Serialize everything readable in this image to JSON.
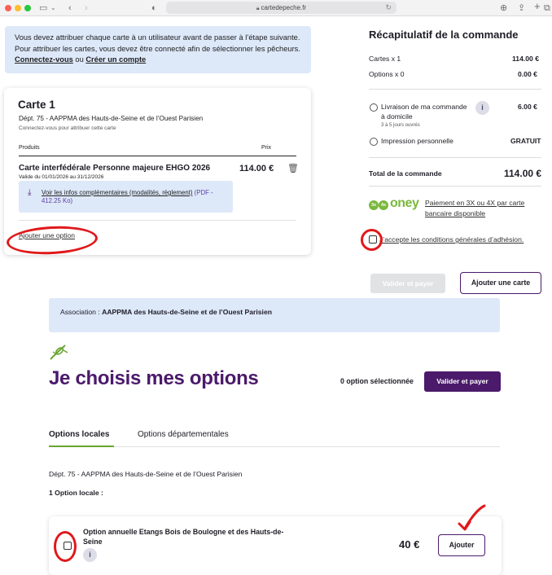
{
  "browser": {
    "url": "cartedepeche.fr"
  },
  "notice": {
    "line1": "Vous devez attribuer chaque carte à un utilisateur avant de passer à l’étape suivante.",
    "line2": "Pour attribuer les cartes, vous devez être connecté afin de sélectionner les pêcheurs.",
    "login_link": "Connectez-vous",
    "or_text": "ou",
    "signup_link": "Créer un compte"
  },
  "card": {
    "title": "Carte 1",
    "subtitle": "Dépt. 75 - AAPPMA des Hauts-de-Seine et de l’Ouest Parisien",
    "connect_hint": "Connectez-vous pour attribuer cette carte",
    "col_products": "Produits",
    "col_price": "Prix",
    "product_name": "Carte interfédérale Personne majeure EHGO 2026",
    "product_validity": "Valide du 01/01/2026 au 31/12/2026",
    "product_price": "114.00 €",
    "info_link": "Voir les infos complémentaires (modalités, règlement)",
    "info_pdf": "(PDF - 412.25 Ko)",
    "add_option": "Ajouter une option"
  },
  "summary": {
    "title": "Récapitulatif de la commande",
    "cards_label": "Cartes x 1",
    "cards_value": "114.00 €",
    "options_label": "Options x 0",
    "options_value": "0.00 €",
    "delivery_label": "Livraison de ma commande à domicile",
    "delivery_note": "3 à 5 jours ouvrés",
    "delivery_value": "6.00 €",
    "print_label": "Impression personnelle",
    "print_value": "GRATUIT",
    "total_label": "Total de la commande",
    "total_value": "114.00 €",
    "oney_logo": "oney",
    "oney_badges": [
      "3x",
      "4x"
    ],
    "oney_text": "Paiement en 3X ou 4X par carte bancaire disponible",
    "terms": "J’accepte les conditions générales d’adhésion.",
    "validate_button": "Valider et payer",
    "add_card_button": "Ajouter une carte"
  },
  "association": {
    "label": "Association :",
    "name": "AAPPMA des Hauts-de-Seine et de l’Ouest Parisien"
  },
  "options": {
    "title": "Je choisis mes options",
    "selected_count": "0 option sélectionnée",
    "validate_button": "Valider et payer",
    "tabs": [
      "Options locales",
      "Options départementales"
    ],
    "dept_line": "Dépt. 75 - AAPPMA des Hauts-de-Seine et de l’Ouest Parisien",
    "count_line": "1 Option locale :",
    "item_name": "Option annuelle Etangs Bois de Boulogne et des Hauts-de-Seine",
    "item_price": "40 €",
    "add_button": "Ajouter"
  },
  "colors": {
    "brand_purple": "#4b1a6b",
    "info_bg": "#dde8f9",
    "accent_green": "#6aa431",
    "annotation_red": "#e0191b"
  }
}
